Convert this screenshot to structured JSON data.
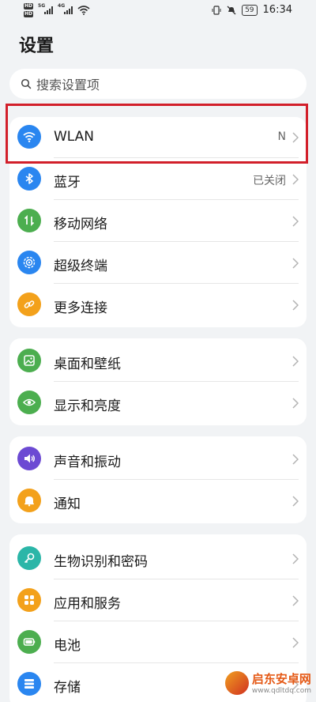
{
  "statusbar": {
    "hd1": "HD",
    "hd2": "HD",
    "net1": "5G",
    "net2": "4G",
    "battery": "59",
    "time": "16:34"
  },
  "page": {
    "title": "设置"
  },
  "search": {
    "placeholder": "搜索设置项"
  },
  "groups": [
    {
      "items": [
        {
          "label": "WLAN",
          "value": "N",
          "icon": "wifi-icon",
          "color": "#2a86f0"
        },
        {
          "label": "蓝牙",
          "value": "已关闭",
          "icon": "bluetooth-icon",
          "color": "#2a86f0"
        },
        {
          "label": "移动网络",
          "value": "",
          "icon": "mobile-data-icon",
          "color": "#4cae4f"
        },
        {
          "label": "超级终端",
          "value": "",
          "icon": "super-device-icon",
          "color": "#2a86f0"
        },
        {
          "label": "更多连接",
          "value": "",
          "icon": "link-icon",
          "color": "#f3a11b"
        }
      ]
    },
    {
      "items": [
        {
          "label": "桌面和壁纸",
          "value": "",
          "icon": "wallpaper-icon",
          "color": "#4cae4f"
        },
        {
          "label": "显示和亮度",
          "value": "",
          "icon": "eye-icon",
          "color": "#4cae4f"
        }
      ]
    },
    {
      "items": [
        {
          "label": "声音和振动",
          "value": "",
          "icon": "speaker-icon",
          "color": "#6c4ad3"
        },
        {
          "label": "通知",
          "value": "",
          "icon": "bell-icon",
          "color": "#f3a11b"
        }
      ]
    },
    {
      "items": [
        {
          "label": "生物识别和密码",
          "value": "",
          "icon": "key-icon",
          "color": "#2bb6a8"
        },
        {
          "label": "应用和服务",
          "value": "",
          "icon": "apps-icon",
          "color": "#f3a11b"
        },
        {
          "label": "电池",
          "value": "",
          "icon": "battery-icon",
          "color": "#4cae4f"
        },
        {
          "label": "存储",
          "value": "",
          "icon": "storage-icon",
          "color": "#2a86f0"
        }
      ]
    }
  ],
  "watermark": {
    "name": "启东安卓网",
    "url": "www.qdltdq.com"
  }
}
